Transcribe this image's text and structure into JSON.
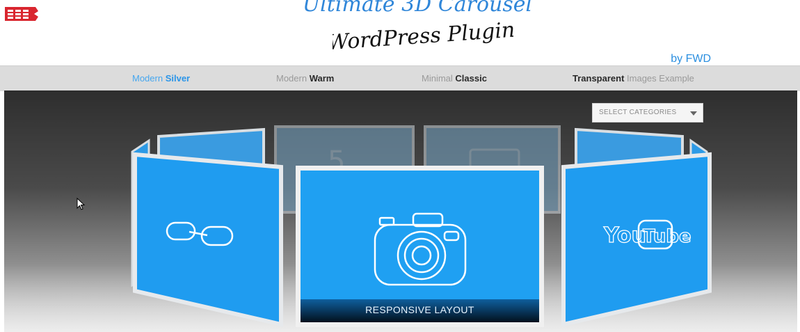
{
  "header": {
    "title_script": "Ultimate 3D Carousel",
    "subtitle_script": "WordPress Plugin",
    "byline": "by FWD"
  },
  "nav": {
    "items": [
      {
        "light": "Modern ",
        "bold": "Silver",
        "active": true
      },
      {
        "light": "Modern ",
        "bold": "Warm",
        "active": false
      },
      {
        "light": "Minimal ",
        "bold": "Classic",
        "active": false
      },
      {
        "bold": "Transparent",
        "light": " Images Example",
        "active": false
      }
    ]
  },
  "categories_select": {
    "value": "SELECT CATEGORIES"
  },
  "carousel": {
    "center_caption": "RESPONSIVE LAYOUT",
    "items": [
      {
        "icon": "link-icon"
      },
      {
        "icon": "camera-icon",
        "caption": "RESPONSIVE LAYOUT"
      },
      {
        "icon": "youtube-icon"
      },
      {
        "icon": "number-5-icon"
      },
      {
        "icon": "monitor-icon"
      }
    ]
  },
  "colors": {
    "accent": "#2b95e8",
    "card_blue": "#1e9bf0",
    "nav_bg": "#dcdcdc"
  }
}
